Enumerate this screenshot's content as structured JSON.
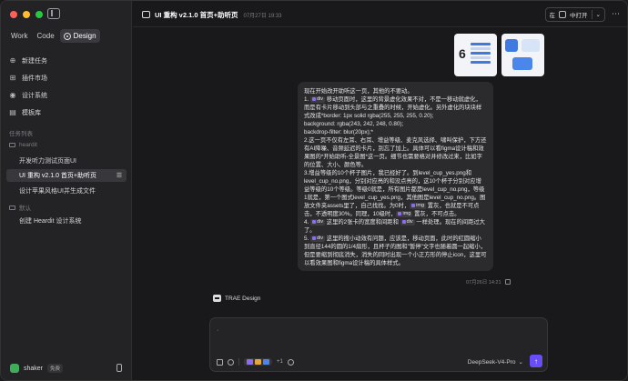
{
  "sidebar": {
    "segments": [
      "Work",
      "Code",
      "Design"
    ],
    "nav": [
      {
        "label": "新建任务",
        "icon": "plus-circle-icon"
      },
      {
        "label": "插件市场",
        "icon": "grid-icon"
      },
      {
        "label": "设计系统",
        "icon": "palette-icon"
      },
      {
        "label": "模板库",
        "icon": "template-icon"
      }
    ],
    "section_label": "任务列表",
    "groups": [
      {
        "name": "heardit",
        "tasks": [
          "开发听力测试页面UI",
          "UI 重构 v2.1.0 首页+助听页",
          "设计苹果风格UI并生成文件"
        ]
      },
      {
        "name": "默认",
        "tasks": [
          "创建 Heardit 设计系统"
        ]
      }
    ],
    "user": {
      "name": "shaker",
      "badge": "免费"
    }
  },
  "header": {
    "title": "UI 重构 v2.1.0 首页+助听页",
    "date": "07月27日 19:33",
    "open_prefix": "在",
    "open_label": "中打开"
  },
  "thumbs": {
    "big_number": "6"
  },
  "message": {
    "lines": [
      "现在开始改开助听这一页，其他的不要动。",
      "1. [div] 移动页面时，这里的背景虚化效果不对，不是一移动就虚化，而是有卡片移动到头部与之重叠的时候，开始虚化。另外虚化的块块样式改成*border: 1px solid rgba(255, 255, 255, 0.20);",
      "background: rgba(243, 242, 248, 0.80);",
      "backdrop-filter: blur(20px);*",
      "2.这一页不仅有左耳、右耳、增益等级、麦克风选择、啸叫保护，下方还有AI降噪、音频延迟的卡片，别忘了加上。具体可以看figma设计稿和效果图的*开始助听-全景图*这一页。细节也需要格对并修改过来，比如字的位置、大小、颜色等。",
      "3.增益等级的10个杯子图片，我已经好了。到level_cup_yes.png和level_cup_no.png，分别对应亮的和没点亮的，这10个杯子分别对应增益等级的10个等级。等级0就是，所有图片都是level_cup_no.png，等级1就是，第一个图式level_cup_yes.png，其他图是level_cup_no.png。图放文件夹assets里了，自己找找。为0时，[img] 置灰，也就是不可点击，不透明度30%。同理，10级时，[img] 置灰，不可点击。",
      "4. [div] 这里的2张卡的宽度和间距和 [div] 一样处理。现在的间距过大了。",
      "5. [div] 这里的搜小动效有问题，应该是，移动页面，此时的红圆缩小到直径144的圆的1/4扇形，且杯子的图和\"暂停\"文字也随着圆一起缩小，但是要缩到彻底消失，消失的同时出现一个小正方形的停止icon，这里可以看效果图和figma设计稿的具体样式。"
    ],
    "timestamp": "07月26日 14:21"
  },
  "assistant": {
    "name": "TRAE Design"
  },
  "composer": {
    "placeholder": "·",
    "attach_count": "+1",
    "model": "DeepSeek-V4-Pro"
  }
}
